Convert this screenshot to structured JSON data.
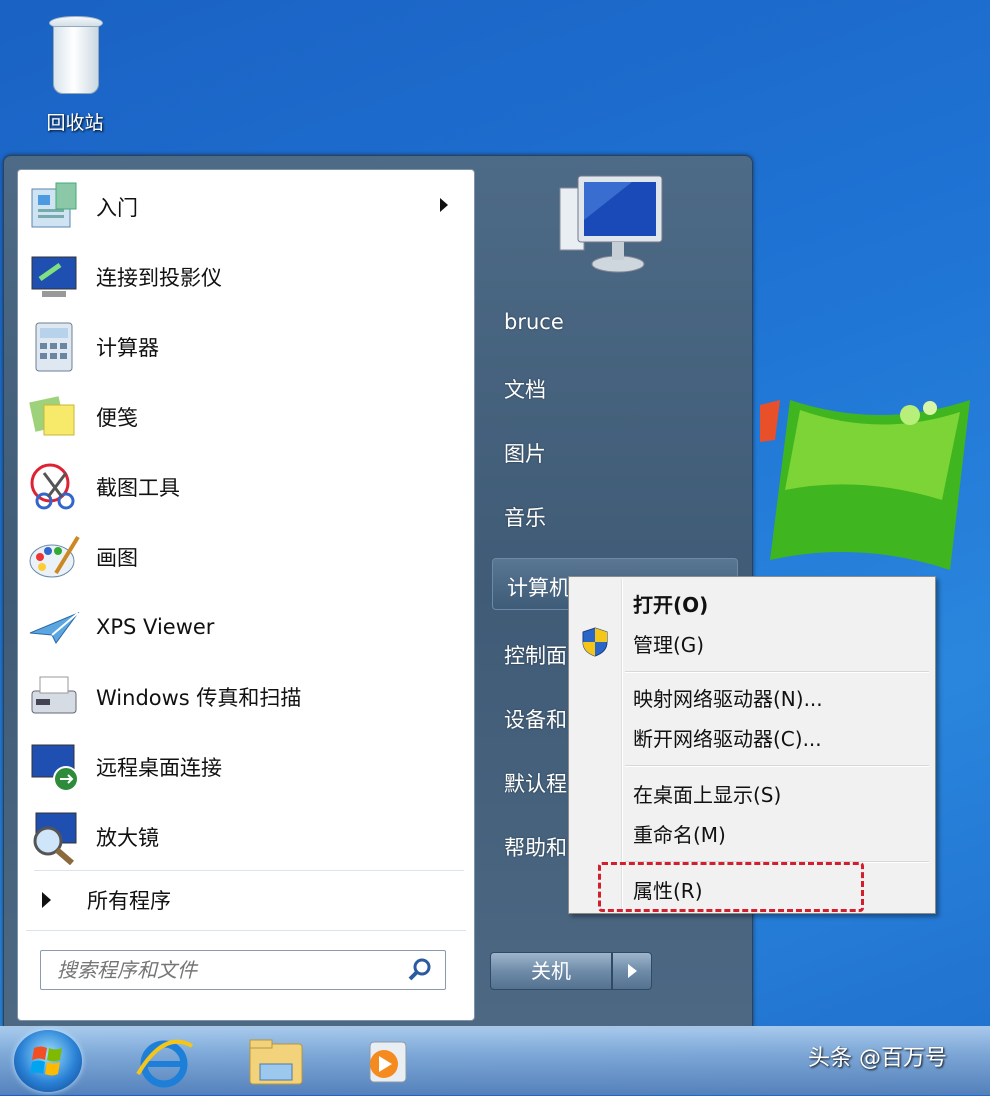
{
  "desktop": {
    "recycle_bin_label": "回收站",
    "watermark": "头条 @百万号"
  },
  "start_menu": {
    "programs": [
      {
        "label": "入门",
        "icon": "getting-started-icon",
        "has_submenu": true
      },
      {
        "label": "连接到投影仪",
        "icon": "projector-icon"
      },
      {
        "label": "计算器",
        "icon": "calculator-icon"
      },
      {
        "label": "便笺",
        "icon": "sticky-notes-icon"
      },
      {
        "label": "截图工具",
        "icon": "snipping-tool-icon"
      },
      {
        "label": "画图",
        "icon": "paint-icon"
      },
      {
        "label": "XPS Viewer",
        "icon": "xps-viewer-icon"
      },
      {
        "label": "Windows 传真和扫描",
        "icon": "fax-scan-icon"
      },
      {
        "label": "远程桌面连接",
        "icon": "remote-desktop-icon"
      },
      {
        "label": "放大镜",
        "icon": "magnifier-icon"
      }
    ],
    "all_programs": "所有程序",
    "search_placeholder": "搜索程序和文件",
    "right_links": {
      "user": "bruce",
      "documents": "文档",
      "pictures": "图片",
      "music": "音乐",
      "computer": "计算机",
      "control_panel": "控制面",
      "devices": "设备和",
      "default_programs": "默认程",
      "help": "帮助和"
    },
    "shutdown_label": "关机"
  },
  "context_menu": {
    "items": {
      "open": "打开(O)",
      "manage": "管理(G)",
      "map_drive": "映射网络驱动器(N)...",
      "disconnect_drive": "断开网络驱动器(C)...",
      "show_desktop": "在桌面上显示(S)",
      "rename": "重命名(M)",
      "properties": "属性(R)"
    },
    "highlighted_item": "properties"
  },
  "colors": {
    "highlight_border": "#d11f2d",
    "desktop_blue": "#1f74d4"
  }
}
